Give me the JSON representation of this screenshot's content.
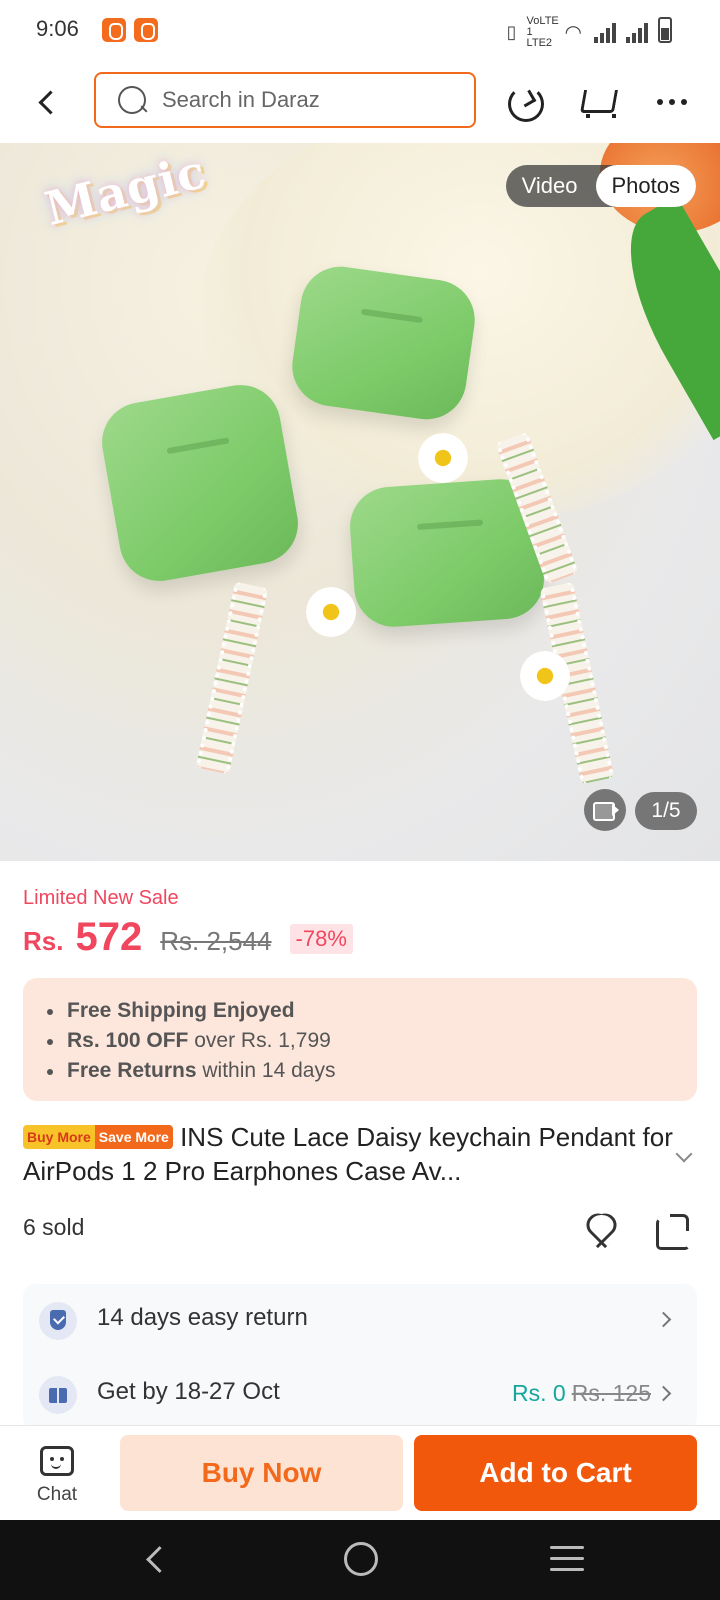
{
  "status_bar": {
    "time": "9:06",
    "network_label": "VoLTE 1 LTE2"
  },
  "search": {
    "placeholder": "Search in Daraz"
  },
  "gallery": {
    "logo_text": "Magic",
    "toggle_video": "Video",
    "toggle_photos": "Photos",
    "selected": "Photos",
    "counter": "1/5"
  },
  "price": {
    "sale_label": "Limited New Sale",
    "currency": "Rs.",
    "current": "572",
    "original": "Rs. 2,544",
    "discount": "-78%"
  },
  "promos": [
    {
      "bold": "Free Shipping Enjoyed",
      "rest": ""
    },
    {
      "bold": "Rs. 100 OFF",
      "rest": " over Rs. 1,799"
    },
    {
      "bold": "Free Returns",
      "rest": " within 14 days"
    }
  ],
  "product": {
    "badge_buy": "Buy More",
    "badge_save": "Save More",
    "title": "INS Cute Lace Daisy keychain Pendant for AirPods 1 2 Pro Earphones Case Av...",
    "sold": "6 sold"
  },
  "services": {
    "return_text": "14 days easy return",
    "delivery_text": "Get by 18-27 Oct",
    "ship_fee": "Rs. 0",
    "ship_fee_original": "Rs. 125"
  },
  "actions": {
    "chat_label": "Chat",
    "buy_now": "Buy Now",
    "add_to_cart": "Add to Cart"
  },
  "colors": {
    "brand_orange": "#f2580c",
    "price_red": "#f0465e",
    "promo_bg": "#fde7dd",
    "free_ship_teal": "#14a79d"
  }
}
